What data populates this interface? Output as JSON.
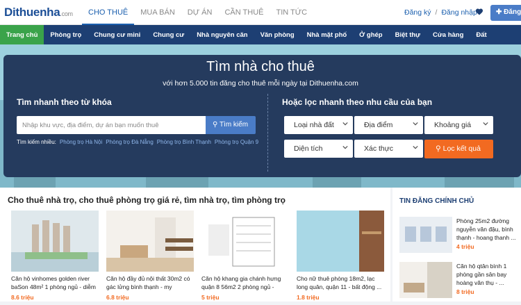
{
  "logo": {
    "brand": "Dithuenha",
    "tld": ".com"
  },
  "topbar": {
    "tabs": [
      "CHO THUÊ",
      "MUA BÁN",
      "DỰ ÁN",
      "CẦN THUÊ",
      "TIN TỨC"
    ],
    "register": "Đăng ký",
    "separator": "/",
    "login": "Đăng nhập",
    "post_button": "Đăng"
  },
  "nav": [
    "Trang chủ",
    "Phòng trọ",
    "Chung cư mini",
    "Chung cư",
    "Nhà nguyên căn",
    "Văn phòng",
    "Nhà mặt phố",
    "Ở ghép",
    "Biệt thự",
    "Cửa hàng",
    "Đất"
  ],
  "hero": {
    "title": "Tìm nhà cho thuê",
    "subtitle": "với hơn 5.000 tin đăng cho thuê mỗi ngày tại Dithuenha.com",
    "keyword_heading": "Tìm nhanh theo từ khóa",
    "filter_heading": "Hoặc lọc nhanh theo nhu cầu của bạn",
    "search_placeholder": "Nhập khu vực, địa điểm, dự án bạn muốn thuê",
    "search_button": "Tìm kiếm",
    "quick_label": "Tìm kiếm nhiều:",
    "quick_links": [
      "Phòng trọ Hà Nội",
      "Phòng trọ Đà Nẵng",
      "Phòng trọ Bình Thạnh",
      "Phòng trọ Quận 9"
    ],
    "filters": [
      "Loại nhà đất",
      "Địa điểm",
      "Khoảng giá",
      "Diện tích",
      "Xác thực"
    ],
    "filter_button": "Lọc kết quả"
  },
  "listings": {
    "title": "Cho thuê nhà trọ, cho thuê phòng trọ giá rẻ, tìm nhà trọ, tìm phòng trọ",
    "items": [
      {
        "title": "Căn hộ vinhomes golden river baSon 48m² 1 phòng ngủ - diễm",
        "price": "8.6 triệu"
      },
      {
        "title": "Căn hộ đầy đủ nội thất 30m2 có gác lửng bình thạnh - my",
        "price": "6.8 triệu"
      },
      {
        "title": "Căn hộ khang gia chánh hưng quận 8 56m2 2 phòng ngủ - nguyễn ...",
        "price": "5 triệu"
      },
      {
        "title": "Cho nữ thuê phòng 18m2, lạc long quân, quận 11 - bất động ...",
        "price": "1.8 triệu"
      }
    ]
  },
  "sidebar": {
    "title": "TIN ĐĂNG CHÍNH CHỦ",
    "items": [
      {
        "title": "Phòng 25m2 đường nguyễn văn đậu, bình thạnh - hoang thanh ...",
        "price": "4 triệu"
      },
      {
        "title": "Căn hộ qtân bình 1 phòng gần sân bay hoàng văn thụ - ...",
        "price": "8 triệu"
      }
    ]
  },
  "colors": {
    "nav_bg": "#1d3f73",
    "nav_active": "#3aa34a",
    "accent_blue": "#4a7cc7",
    "orange": "#f26a21"
  }
}
